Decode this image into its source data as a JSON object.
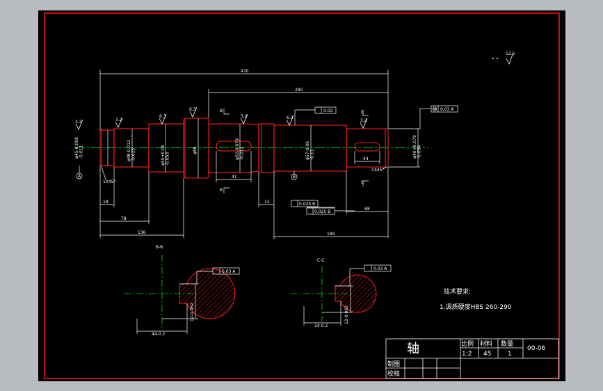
{
  "colors": {
    "background": "#b9bcc0",
    "paper": "#000000",
    "border": "#ff1a1a",
    "outline": "#ff2020",
    "dimension": "#ffffff",
    "centerline": "#00e000",
    "hatch": "#ff2020"
  },
  "drawing": {
    "roughness_other": "12.5",
    "dimensions": {
      "overall": "470",
      "right_span": "290",
      "d_136": "136",
      "d_78": "78",
      "d_18": "18",
      "d_12": "12",
      "d_68": "68",
      "d_184": "184",
      "key_41": "41",
      "key_44": "44",
      "chamfer_left": "1X45°",
      "chamfer_right": "1X45°"
    },
    "diameters": {
      "d1": "φ45-0.008\n-0.011",
      "d2": "φ48-0.012\n-0.025",
      "d3": "φ55+0.05\n-0.053",
      "d4": "φ60",
      "d5": "φ52-0.079\n-0.012",
      "d6": "φ57-0.06\n-0.11",
      "d7": "φ40+0.079\n-0.054"
    },
    "roughness": [
      "3.2",
      "3.2",
      "6.3",
      "6.3",
      "3.2",
      "6.3",
      "3.2"
    ],
    "gdt": {
      "runout_top": "0.03",
      "coax_right": "0.03 A",
      "f1": "0.025 B",
      "f2": "0.025 B"
    },
    "datums": {
      "a": "A",
      "b": "B",
      "c": "C"
    },
    "section_b": {
      "label": "B-B",
      "gdt": "0.03 A",
      "width": "44-0.2",
      "depth": "12-0.062"
    },
    "section_c": {
      "label": "C-C",
      "gdt": "0.03 A",
      "width": "24-0.2",
      "depth": "12-0.062"
    },
    "tech_title": "技术要求:",
    "tech_note": "1.调质硬度HBS  260-290"
  },
  "title_block": {
    "part_name": "轴",
    "scale_label": "比例",
    "material_label": "材料",
    "quantity_label": "数量",
    "scale_value": "1:2",
    "material_value": "45",
    "quantity_value": "1",
    "drawing_no": "00-06",
    "drawn_label": "制图",
    "checked_label": "校核"
  }
}
